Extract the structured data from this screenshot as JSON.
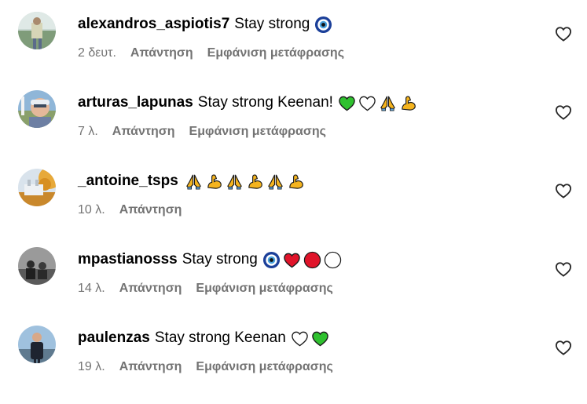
{
  "comments": [
    {
      "username": "alexandros_aspiotis7",
      "text": "Stay strong",
      "emojis": [
        "nazar-icon"
      ],
      "time": "2 δευτ.",
      "reply_label": "Απάντηση",
      "translate_label": "Εμφάνιση μετάφρασης"
    },
    {
      "username": "arturas_lapunas",
      "text": "Stay strong Keenan!",
      "emojis": [
        "green-heart-icon",
        "white-heart-icon",
        "folded-hands-icon",
        "flexed-biceps-icon"
      ],
      "time": "7 λ.",
      "reply_label": "Απάντηση",
      "translate_label": "Εμφάνιση μετάφρασης"
    },
    {
      "username": "_antoine_tsps",
      "text": "",
      "emojis": [
        "folded-hands-icon",
        "flexed-biceps-icon",
        "folded-hands-icon",
        "flexed-biceps-icon",
        "folded-hands-icon",
        "flexed-biceps-icon"
      ],
      "time": "10 λ.",
      "reply_label": "Απάντηση",
      "translate_label": ""
    },
    {
      "username": "mpastianosss",
      "text": "Stay strong",
      "emojis": [
        "nazar-icon",
        "red-heart-icon",
        "red-circle-icon",
        "white-circle-icon"
      ],
      "time": "14 λ.",
      "reply_label": "Απάντηση",
      "translate_label": "Εμφάνιση μετάφρασης"
    },
    {
      "username": "paulenzas",
      "text": "Stay strong Keenan",
      "emojis": [
        "white-heart-icon",
        "green-heart-icon"
      ],
      "time": "19 λ.",
      "reply_label": "Απάντηση",
      "translate_label": "Εμφάνιση μετάφρασης"
    }
  ],
  "colors": {
    "meta_text": "#737373",
    "green_heart": "#2fc12f",
    "red_heart": "#e0142a",
    "emoji_yellow": "#f5b41e",
    "nazar_blue": "#1b3f99"
  }
}
